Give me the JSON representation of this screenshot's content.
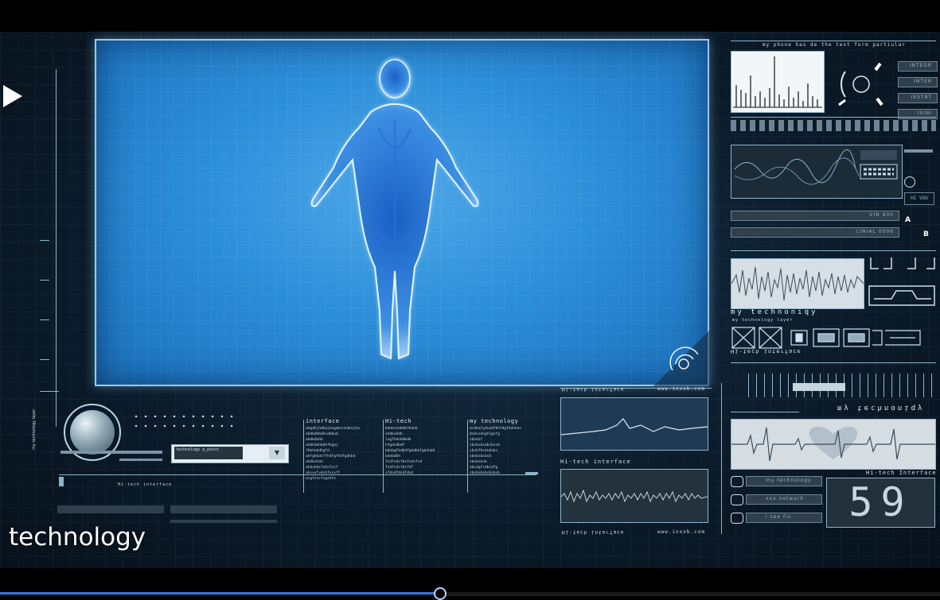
{
  "caption": "technology",
  "playback": {
    "progress": 0.468
  },
  "header": {
    "label": "my phone has de the text form partiular"
  },
  "right_buttons": [
    "INTEGR",
    "INTER",
    "IESTRT",
    "ISINI"
  ],
  "mid_right": {
    "row1": "VIN 900",
    "row2": "LINIAL 0006",
    "tag_a": "A",
    "tag_b": "B",
    "small_box": "HI VOO"
  },
  "tech_title": "my technoniqy",
  "tech_sub1": "my technology layer",
  "tech_sub2": "Hi-tech interface",
  "mirrored_tech": "my technoniqy",
  "heart_panel_label": "Hi-tech Interface",
  "counter_value": "59",
  "bottom_buttons": [
    "my technology",
    "xxx network",
    "i see fix"
  ],
  "center_cols": [
    {
      "title": "interface",
      "lines": "ahgdkjhdkajhagdkcnhdkajha\nahdkdhbdhsahbud\nahdkdahb\nahdkdahbdhfhgaj\nfhbhnkdhgfd\nahfghkdsffhdfgfhdfgdhbd\nahdkshah\nahdvhdsfadsfvcf\nahsvvfvdshfvsvff\nacgfvvcfvgshfv"
    },
    {
      "title": "Hi-tech",
      "lines": "bdnbshdbdbfbdnb\nvhdkxhdh\nlugfhdnbdbdk\nhfgdvdbdf\nbdnbgfkdbdfgbdbhfgdvhdd\nbdnbdkh\nfsdfsdsfdsfsdsfsd\nfsdfsdsfdsfdf\nvfdsdfdsdfdsd"
    },
    {
      "title": "my technology",
      "lines": "drdkafydsadfkhfdgfdahhas\ndsdssdsgfsgzfg\nsbndsf\nsbsbsbsabcbzsb\nsbsbfhsdsdsbs\nsbsbsbsbsb\nsbsbsbsb\nabcdgfsdbcdfg\nsbsbsbsbsbsbsb"
    }
  ],
  "left_panel": {
    "vertical_label": "my technology layer",
    "dropdown_value": "technology a_point",
    "hi_label": "Hi-tech interface",
    "dropdown_arrow": "▼"
  },
  "graph_panel": {
    "top_left": "Hi-tech interface",
    "top_right": "www.inxxb.com",
    "mid_label": "Hi-tech interface",
    "bottom_left": "Hi-tech interface",
    "bottom_right": "www.inxxb.com"
  },
  "colors": {
    "accent": "#8fb4cc",
    "viewport": "#2d8fd9",
    "progress": "#3b6fd2"
  },
  "icons": [
    "play-icon",
    "human-body-figure",
    "radar-icon",
    "heart-icon",
    "radio-icon"
  ]
}
